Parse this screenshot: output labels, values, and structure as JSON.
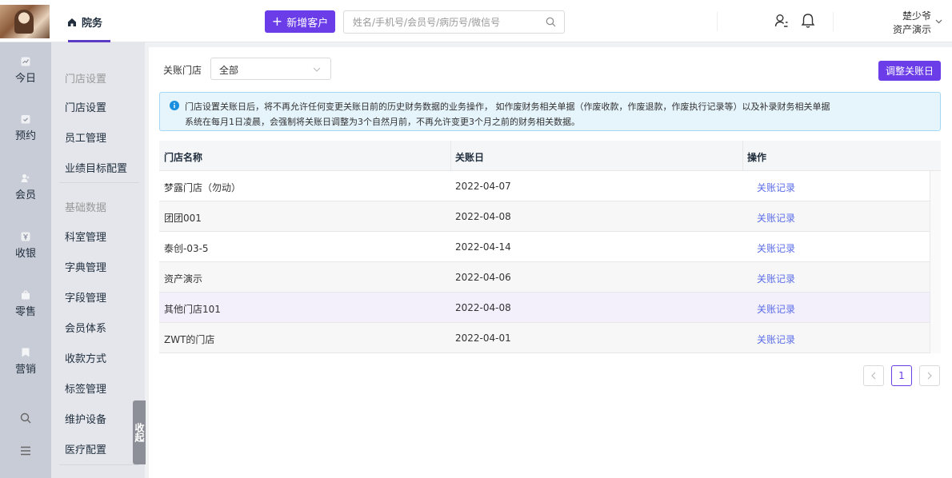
{
  "header": {
    "nav_label": "院务",
    "add_button": "新增客户",
    "search_placeholder": "姓名/手机号/会员号/病历号/微信号",
    "user_name": "楚少爷",
    "user_store": "资产演示"
  },
  "iconbar": {
    "items": [
      {
        "label": "今日",
        "icon": "chart-icon"
      },
      {
        "label": "预约",
        "icon": "calendar-check-icon"
      },
      {
        "label": "会员",
        "icon": "members-icon"
      },
      {
        "label": "收银",
        "icon": "cashier-icon"
      },
      {
        "label": "零售",
        "icon": "shopping-bag-icon"
      },
      {
        "label": "营销",
        "icon": "bookmark-icon"
      }
    ]
  },
  "submenu": {
    "group1": "门店设置",
    "group1_items": [
      "门店设置",
      "员工管理",
      "业绩目标配置"
    ],
    "group2": "基础数据",
    "group2_items": [
      "科室管理",
      "字典管理",
      "字段管理",
      "会员体系",
      "收款方式",
      "标签管理",
      "维护设备",
      "医疗配置"
    ],
    "collapse_label": "收起"
  },
  "filter": {
    "label": "关账门店",
    "selected": "全部"
  },
  "adjust_button": "调整关账日",
  "notice": {
    "line1": "门店设置关账日后，将不再允许任何变更关账日前的历史财务数据的业务操作， 如作废财务相关单据（作废收款，作废退款，作废执行记录等）以及补录财务相关单据",
    "line2": "系统在每月1日凌晨，会强制将关账日调整为3个自然月前，不再允许变更3个月之前的财务相关数据。"
  },
  "table": {
    "headers": [
      "门店名称",
      "关账日",
      "操作"
    ],
    "rows": [
      {
        "store": "梦露门店（勿动）",
        "date": "2022-04-07",
        "action": "关账记录"
      },
      {
        "store": "团团001",
        "date": "2022-04-08",
        "action": "关账记录"
      },
      {
        "store": "泰创-03-5",
        "date": "2022-04-14",
        "action": "关账记录"
      },
      {
        "store": "资产演示",
        "date": "2022-04-06",
        "action": "关账记录"
      },
      {
        "store": "其他门店101",
        "date": "2022-04-08",
        "action": "关账记录"
      },
      {
        "store": "ZWT的门店",
        "date": "2022-04-01",
        "action": "关账记录"
      }
    ]
  },
  "pagination": {
    "current_page": "1"
  },
  "colors": {
    "primary": "#6a3de8",
    "link": "#5b6de8",
    "row_highlight": "#f3effb"
  }
}
